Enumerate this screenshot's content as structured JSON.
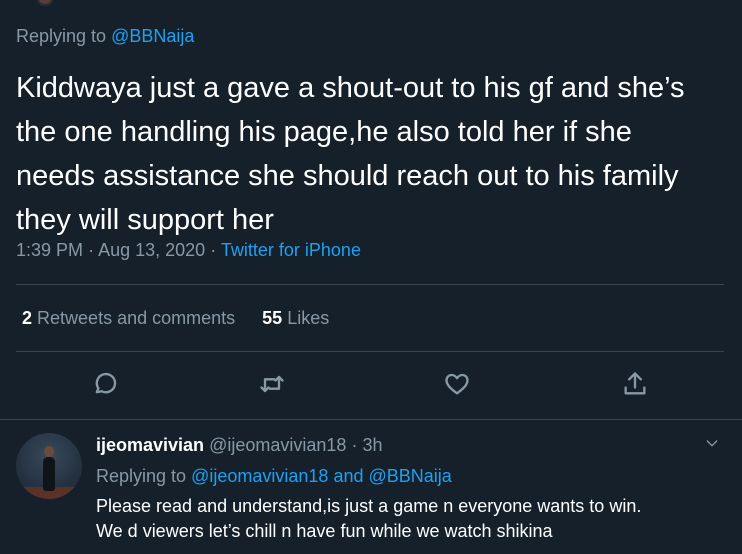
{
  "main_tweet": {
    "replying_prefix": "Replying to",
    "replying_to": "@BBNaija",
    "text_lines": [
      "Kiddwaya just a gave a shout-out to his gf and she’s",
      "the one handling his page,he also told her if she",
      "needs assistance she should reach out to his family",
      "they will support her"
    ],
    "time": "1:39 PM",
    "date": "Aug 13, 2020",
    "separator": "·",
    "source": "Twitter for iPhone",
    "retweets_count": "2",
    "retweets_label": "Retweets and comments",
    "likes_count": "55",
    "likes_label": "Likes"
  },
  "actions": [
    {
      "name": "reply",
      "icon": "comment-icon"
    },
    {
      "name": "retweet",
      "icon": "retweet-icon"
    },
    {
      "name": "like",
      "icon": "heart-icon"
    },
    {
      "name": "share",
      "icon": "share-icon"
    }
  ],
  "reply_tweet": {
    "display_name": "ijeomavivian",
    "handle": "@ijeomavivian18",
    "separator": "·",
    "time": "3h",
    "replying_prefix": "Replying to",
    "replying_to_1": "@ijeomavivian18",
    "conjunction": "and",
    "replying_to_2": "@BBNaija",
    "text_lines": [
      "Please read and understand,is just a game n everyone wants to win.",
      "We d viewers let’s chill n have fun while we watch shikina"
    ]
  },
  "colors": {
    "background": "#15202b",
    "text": "#ffffff",
    "secondary_text": "#8899a6",
    "accent": "#1da1f2",
    "divider": "#38444d"
  }
}
